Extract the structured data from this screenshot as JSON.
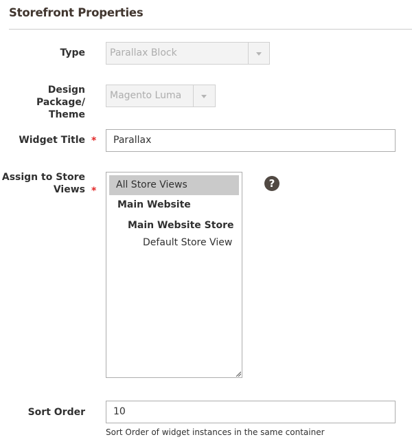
{
  "section": {
    "title": "Storefront Properties"
  },
  "type_field": {
    "label": "Type",
    "value": "Parallax Block"
  },
  "theme_field": {
    "label_line1": "Design Package/",
    "label_line2": "Theme",
    "value": "Magento Luma"
  },
  "title_field": {
    "label": "Widget Title",
    "required_mark": "*",
    "value": "Parallax"
  },
  "store_views_field": {
    "label_line1": "Assign to Store",
    "label_line2": "Views",
    "required_mark": "*",
    "options": [
      {
        "label": "All Store Views",
        "selected": true,
        "bold": false
      },
      {
        "label": "Main Website",
        "selected": false,
        "bold": true
      },
      {
        "label": "Main Website Store",
        "selected": false,
        "bold": true
      },
      {
        "label": "Default Store View",
        "selected": false,
        "bold": false
      }
    ],
    "help_glyph": "?"
  },
  "sort_order_field": {
    "label": "Sort Order",
    "value": "10",
    "note": "Sort Order of widget instances in the same container"
  },
  "icons": {
    "select_caret": "chevron-down-icon",
    "help": "question-circle-icon",
    "resize": "resize-grip-icon"
  },
  "colors": {
    "required": "#e22626",
    "help_bg": "#514943",
    "selected_option_bg": "#cacaca",
    "disabled_bg": "#f3f3f3"
  }
}
